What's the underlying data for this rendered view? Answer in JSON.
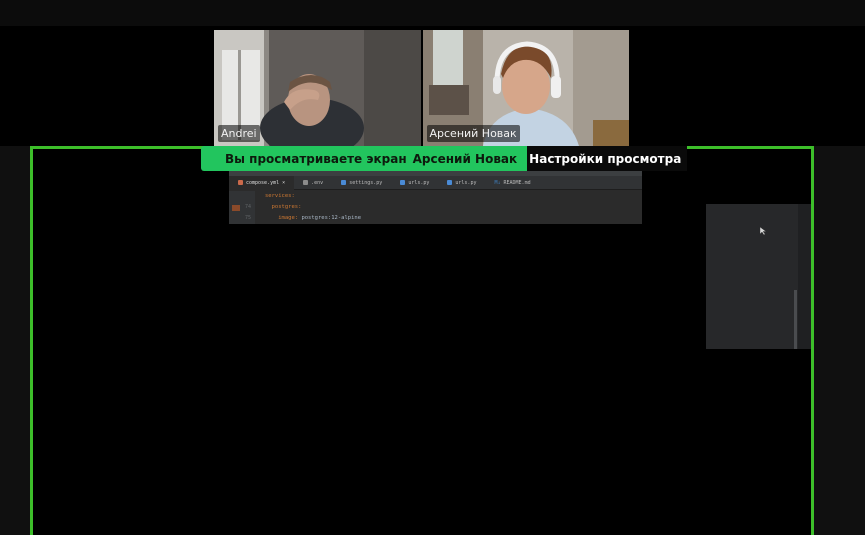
{
  "participants": [
    {
      "name": "Andrei"
    },
    {
      "name": "Арсений Новак"
    }
  ],
  "share_banner": {
    "viewing_label": "Вы просматриваете экран",
    "presenter_name": "Арсений Новак",
    "view_options_label": "Настройки просмотра"
  },
  "shared_screen": {
    "tabs": [
      {
        "label": "compose.yml",
        "icon": "yaml-file-icon",
        "color": "#cb6a4b",
        "active": true,
        "close": "×"
      },
      {
        "label": ".env",
        "icon": "env-file-icon",
        "color": "#8c8c8c",
        "active": false
      },
      {
        "label": "settings.py",
        "icon": "python-file-icon",
        "color": "#4a8bd6",
        "active": false
      },
      {
        "label": "urls.py",
        "icon": "python-file-icon",
        "color": "#4a8bd6",
        "active": false
      },
      {
        "label": "urls.py",
        "icon": "python-file-icon",
        "color": "#4a8bd6",
        "active": false
      },
      {
        "label": "README.md",
        "icon": "markdown-file-icon",
        "color": "#3f7fbf",
        "active": false,
        "prefix": "M↓"
      }
    ],
    "line_numbers": [
      "",
      "74",
      "75"
    ],
    "code_lines": [
      {
        "key": "services:",
        "value": ""
      },
      {
        "key": "  postgres:",
        "value": ""
      },
      {
        "key": "    image: ",
        "value": "postgres:12-alpine"
      }
    ]
  },
  "colors": {
    "share_border": "#3dbf2a",
    "banner_green": "#22c55e",
    "banner_dark": "#0a0a0a"
  }
}
